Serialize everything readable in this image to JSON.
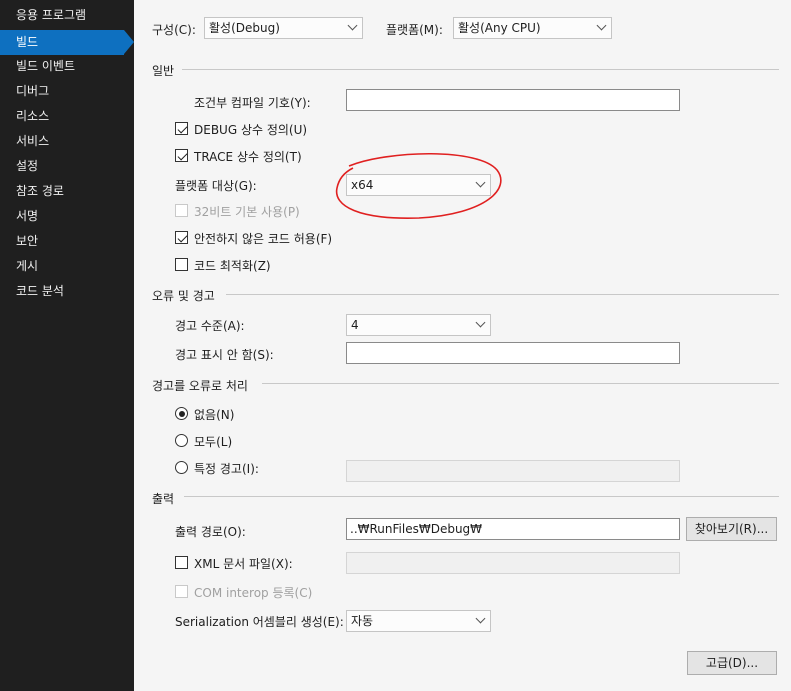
{
  "sidebar": {
    "items": [
      {
        "label": "응용 프로그램"
      },
      {
        "label": "빌드"
      },
      {
        "label": "빌드 이벤트"
      },
      {
        "label": "디버그"
      },
      {
        "label": "리소스"
      },
      {
        "label": "서비스"
      },
      {
        "label": "설정"
      },
      {
        "label": "참조 경로"
      },
      {
        "label": "서명"
      },
      {
        "label": "보안"
      },
      {
        "label": "게시"
      },
      {
        "label": "코드 분석"
      }
    ],
    "active_index": 1
  },
  "header": {
    "configuration_label": "구성(C):",
    "configuration_value": "활성(Debug)",
    "platform_label": "플랫폼(M):",
    "platform_value": "활성(Any CPU)"
  },
  "general": {
    "section_title": "일반",
    "conditional_symbols_label": "조건부 컴파일 기호(Y):",
    "conditional_symbols_value": "",
    "define_debug_label": "DEBUG 상수 정의(U)",
    "define_debug_checked": true,
    "define_trace_label": "TRACE 상수 정의(T)",
    "define_trace_checked": true,
    "platform_target_label": "플랫폼 대상(G):",
    "platform_target_value": "x64",
    "prefer32_label": "32비트 기본 사용(P)",
    "prefer32_checked": false,
    "prefer32_enabled": false,
    "unsafe_label": "안전하지 않은 코드 허용(F)",
    "unsafe_checked": true,
    "optimize_label": "코드 최적화(Z)",
    "optimize_checked": false,
    "annotation_color": "#e02020"
  },
  "errors": {
    "section_title": "오류 및 경고",
    "warning_level_label": "경고 수준(A):",
    "warning_level_value": "4",
    "suppress_label": "경고 표시 안 함(S):",
    "suppress_value": ""
  },
  "treat_warnings": {
    "section_title": "경고를 오류로 처리",
    "none_label": "없음(N)",
    "all_label": "모두(L)",
    "specific_label": "특정 경고(I):",
    "selected": "none",
    "specific_value": ""
  },
  "output": {
    "section_title": "출력",
    "output_path_label": "출력 경로(O):",
    "output_path_value": "..₩RunFiles₩Debug₩",
    "browse_label": "찾아보기(R)...",
    "xml_doc_label": "XML 문서 파일(X):",
    "xml_doc_checked": false,
    "xml_doc_value": "",
    "com_interop_label": "COM interop 등록(C)",
    "com_interop_checked": false,
    "serialization_label": "Serialization 어셈블리 생성(E):",
    "serialization_value": "자동",
    "advanced_label": "고급(D)..."
  },
  "colors": {
    "sidebar_bg": "#1f1f1f",
    "sidebar_active": "#0e70c0",
    "content_bg": "#f5f5f5"
  }
}
